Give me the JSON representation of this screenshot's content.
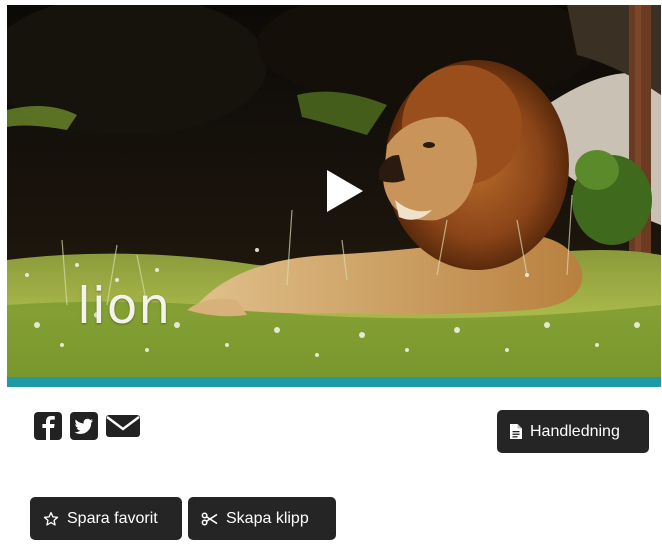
{
  "video": {
    "title": "lion",
    "accent_color": "#1f9aa5"
  },
  "share": {
    "icons": [
      "facebook-icon",
      "twitter-icon",
      "email-icon"
    ]
  },
  "buttons": {
    "guide_label": "Handledning",
    "favorite_label": "Spara favorit",
    "clip_label": "Skapa klipp"
  }
}
